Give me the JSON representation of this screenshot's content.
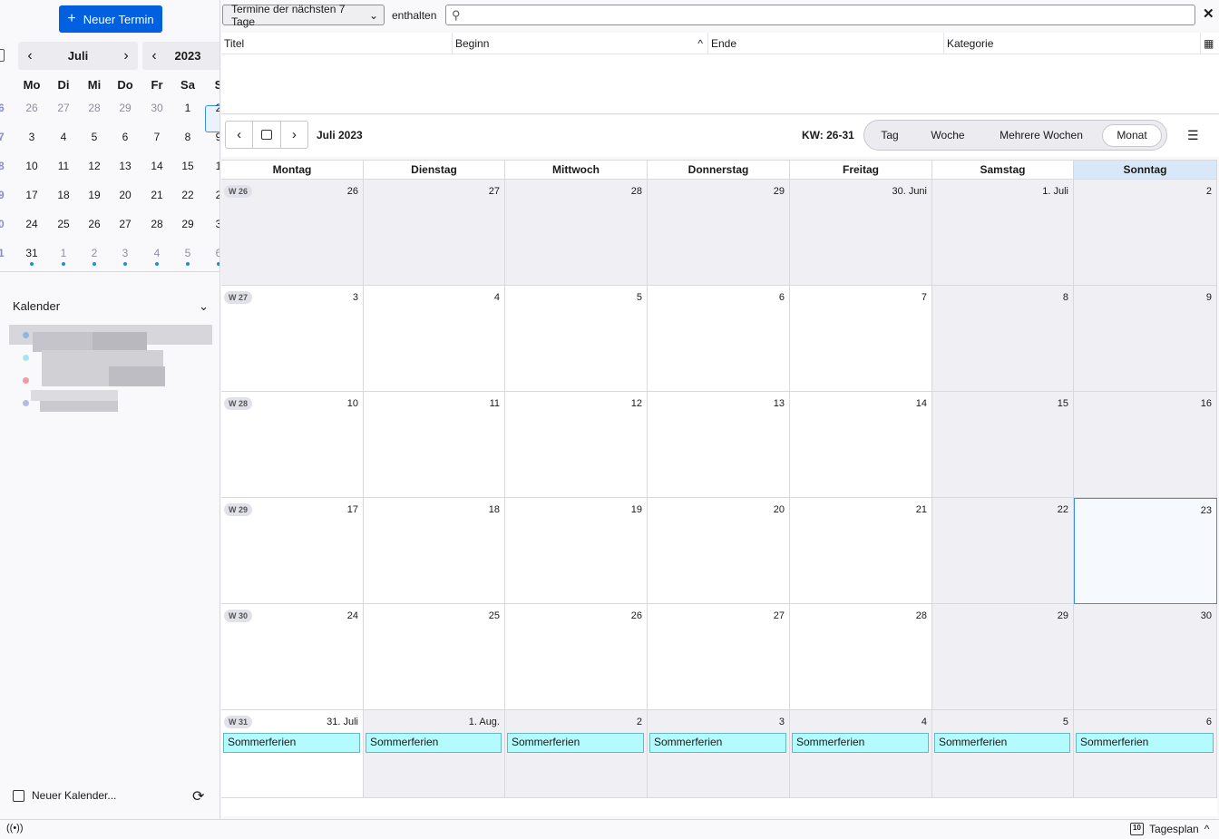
{
  "sidebar": {
    "new_event_label": "Neuer Termin",
    "mini_month": "Juli",
    "mini_year": "2023",
    "weekdays": [
      "Mo",
      "Di",
      "Mi",
      "Do",
      "Fr",
      "Sa",
      "S"
    ],
    "weeks": [
      {
        "wk": "6",
        "days": [
          "26",
          "27",
          "28",
          "29",
          "30",
          "1",
          "2"
        ],
        "dim": [
          true,
          true,
          true,
          true,
          true,
          false,
          false
        ]
      },
      {
        "wk": "7",
        "days": [
          "3",
          "4",
          "5",
          "6",
          "7",
          "8",
          "9"
        ],
        "dim": [
          false,
          false,
          false,
          false,
          false,
          false,
          false
        ]
      },
      {
        "wk": "8",
        "days": [
          "10",
          "11",
          "12",
          "13",
          "14",
          "15",
          "1"
        ],
        "dim": [
          false,
          false,
          false,
          false,
          false,
          false,
          false
        ]
      },
      {
        "wk": "9",
        "days": [
          "17",
          "18",
          "19",
          "20",
          "21",
          "22",
          "2"
        ],
        "dim": [
          false,
          false,
          false,
          false,
          false,
          false,
          false
        ]
      },
      {
        "wk": "0",
        "days": [
          "24",
          "25",
          "26",
          "27",
          "28",
          "29",
          "3"
        ],
        "dim": [
          false,
          false,
          false,
          false,
          false,
          false,
          false
        ]
      },
      {
        "wk": "1",
        "days": [
          "31",
          "1",
          "2",
          "3",
          "4",
          "5",
          "6"
        ],
        "dim": [
          false,
          true,
          true,
          true,
          true,
          true,
          true
        ]
      }
    ],
    "calendars_heading": "Kalender",
    "new_calendar_label": "Neuer Kalender..."
  },
  "search": {
    "filter_value": "Termine der nächsten 7 Tage",
    "contains_label": "enthalten",
    "query": ""
  },
  "list_columns": [
    "Titel",
    "Beginn",
    "Ende",
    "Kategorie"
  ],
  "toolbar": {
    "month_title": "Juli 2023",
    "week_range": "KW: 26-31",
    "views": [
      "Tag",
      "Woche",
      "Mehrere Wochen",
      "Monat"
    ],
    "active_view": "Monat"
  },
  "month_view": {
    "day_headers": [
      "Montag",
      "Dienstag",
      "Mittwoch",
      "Donnerstag",
      "Freitag",
      "Samstag",
      "Sonntag"
    ],
    "weeks": [
      {
        "label": "W 26",
        "days": [
          "26",
          "27",
          "28",
          "29",
          "30. Juni",
          "1. Juli",
          "2"
        ]
      },
      {
        "label": "W 27",
        "days": [
          "3",
          "4",
          "5",
          "6",
          "7",
          "8",
          "9"
        ]
      },
      {
        "label": "W 28",
        "days": [
          "10",
          "11",
          "12",
          "13",
          "14",
          "15",
          "16"
        ]
      },
      {
        "label": "W 29",
        "days": [
          "17",
          "18",
          "19",
          "20",
          "21",
          "22",
          "23"
        ]
      },
      {
        "label": "W 30",
        "days": [
          "24",
          "25",
          "26",
          "27",
          "28",
          "29",
          "30"
        ]
      },
      {
        "label": "W 31",
        "days": [
          "31. Juli",
          "1. Aug.",
          "2",
          "3",
          "4",
          "5",
          "6"
        ]
      }
    ],
    "event_title": "Sommerferien",
    "event_color": "#b3fbff"
  },
  "statusbar": {
    "today_pane_label": "Tagesplan",
    "today_pane_icon_day": "10"
  }
}
